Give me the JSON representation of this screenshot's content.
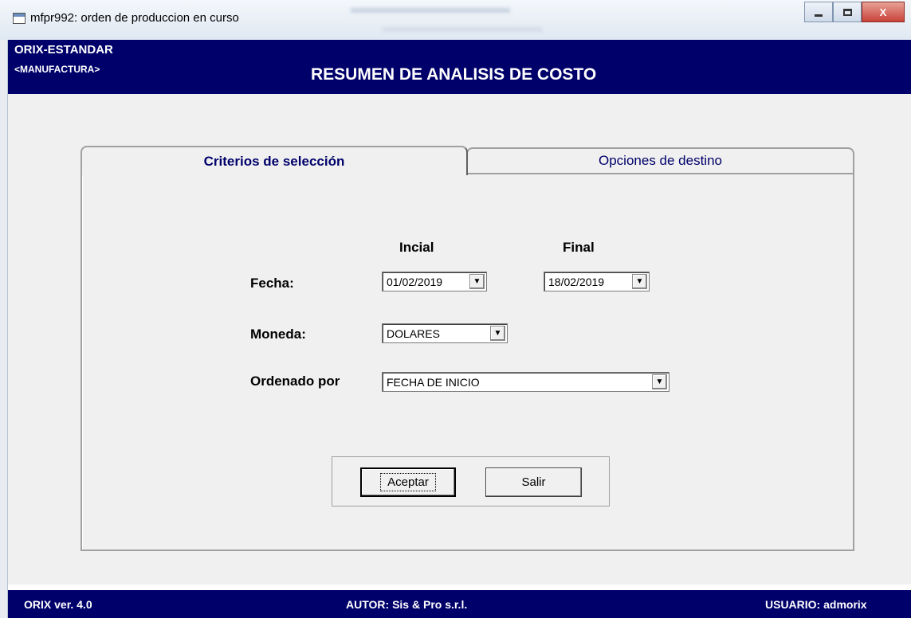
{
  "window": {
    "title": "mfpr992: orden de produccion en curso",
    "controls": {
      "minimize": "–",
      "maximize": "□",
      "close": "X"
    }
  },
  "header": {
    "brand": "ORIX-ESTANDAR",
    "module": "<MANUFACTURA>",
    "report_title": "RESUMEN DE ANALISIS DE COSTO"
  },
  "tabs": [
    {
      "label": "Criterios de selección",
      "active": true
    },
    {
      "label": "Opciones de destino",
      "active": false
    }
  ],
  "form": {
    "col_initial": "Incial",
    "col_final": "Final",
    "fecha_label": "Fecha:",
    "fecha_inicial": "01/02/2019",
    "fecha_final": "18/02/2019",
    "moneda_label": "Moneda:",
    "moneda_value": "DOLARES",
    "ordenado_label": "Ordenado por",
    "ordenado_value": "FECHA DE INICIO"
  },
  "buttons": {
    "accept": "Aceptar",
    "exit": "Salir"
  },
  "status": {
    "version": "ORIX ver. 4.0",
    "author": "AUTOR: Sis & Pro s.r.l.",
    "user": "USUARIO: admorix"
  },
  "colors": {
    "brand_navy": "#00006b",
    "panel_gray": "#f0f0f0"
  }
}
